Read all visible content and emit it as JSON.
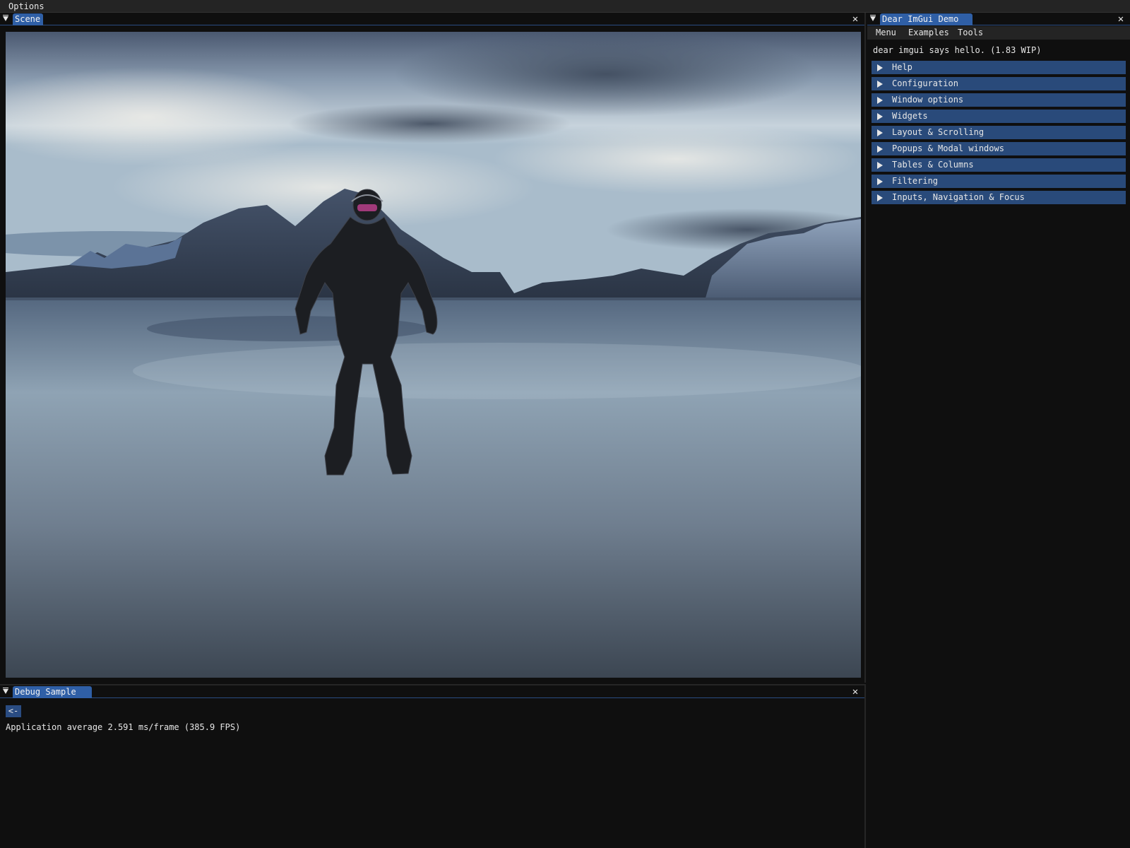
{
  "main_menu": {
    "options": "Options"
  },
  "scene_window": {
    "title": "Scene",
    "close_glyph": "✕"
  },
  "debug_window": {
    "title": "Debug Sample",
    "close_glyph": "✕",
    "back_button": "<-",
    "fps_text": "Application average 2.591 ms/frame (385.9 FPS)"
  },
  "demo_window": {
    "title": "Dear ImGui Demo",
    "close_glyph": "✕",
    "menu": [
      "Menu",
      "Examples",
      "Tools"
    ],
    "hello": "dear imgui says hello. (1.83 WIP)",
    "headers": [
      "Help",
      "Configuration",
      "Window options",
      "Widgets",
      "Layout & Scrolling",
      "Popups & Modal windows",
      "Tables & Columns",
      "Filtering",
      "Inputs, Navigation & Focus"
    ]
  },
  "colors": {
    "accent_tab": "#2f5fa6",
    "header_bg": "#294a7a",
    "window_bg": "#0f0f0f",
    "menubar_bg": "#242424"
  }
}
